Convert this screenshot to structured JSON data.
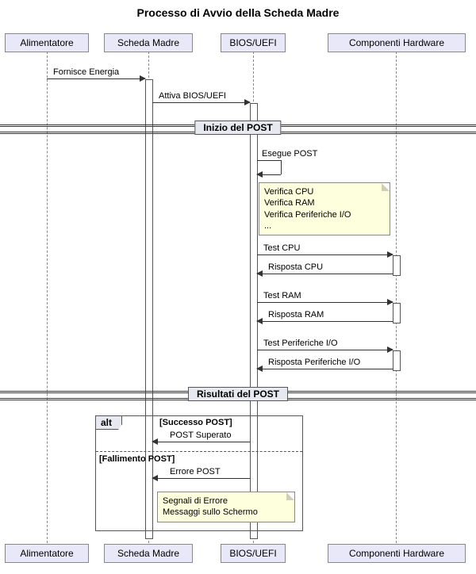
{
  "title": "Processo di Avvio della Scheda Madre",
  "participants": {
    "p1": "Alimentatore",
    "p2": "Scheda Madre",
    "p3": "BIOS/UEFI",
    "p4": "Componenti Hardware"
  },
  "messages": {
    "m1": "Fornisce Energia",
    "m2": "Attiva BIOS/UEFI",
    "m3": "Esegue POST",
    "m4": "Test CPU",
    "m5": "Risposta CPU",
    "m6": "Test RAM",
    "m7": "Risposta RAM",
    "m8": "Test Periferiche I/O",
    "m9": "Risposta Periferiche I/O",
    "m10": "POST Superato",
    "m11": "Errore POST"
  },
  "dividers": {
    "d1": "Inizio del POST",
    "d2": "Risultati del POST"
  },
  "notes": {
    "n1l1": "Verifica CPU",
    "n1l2": "Verifica RAM",
    "n1l3": "Verifica Periferiche I/O",
    "n1l4": "...",
    "n2l1": "Segnali di Errore",
    "n2l2": "Messaggi sullo Schermo"
  },
  "alt": {
    "label": "alt",
    "guard1": "[Successo POST]",
    "guard2": "[Fallimento POST]"
  }
}
